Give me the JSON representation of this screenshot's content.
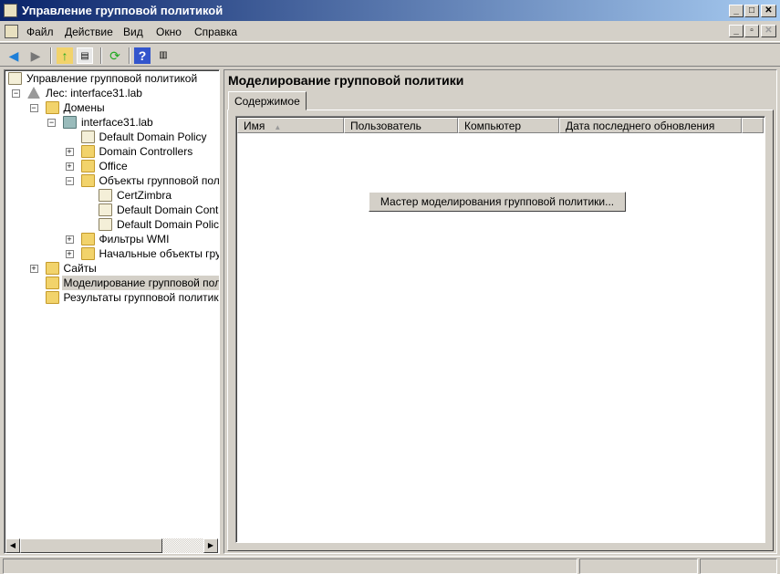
{
  "window": {
    "title": "Управление групповой политикой"
  },
  "menu": [
    "Файл",
    "Действие",
    "Вид",
    "Окно",
    "Справка"
  ],
  "toolbar": {
    "back": "back",
    "forward": "forward",
    "up": "up",
    "show_tree": "show-tree",
    "refresh": "refresh",
    "help": "help",
    "action_pane": "action-pane"
  },
  "tree": [
    {
      "label": "Управление групповой политикой",
      "level": 0,
      "expander": "",
      "icon": "gpmc"
    },
    {
      "label": "Лес: interface31.lab",
      "level": 1,
      "expander": "-",
      "icon": "forest"
    },
    {
      "label": "Домены",
      "level": 2,
      "expander": "-",
      "icon": "domains"
    },
    {
      "label": "interface31.lab",
      "level": 3,
      "expander": "-",
      "icon": "domain"
    },
    {
      "label": "Default Domain Policy",
      "level": 4,
      "expander": "",
      "icon": "gpo-link"
    },
    {
      "label": "Domain Controllers",
      "level": 4,
      "expander": "+",
      "icon": "ou"
    },
    {
      "label": "Office",
      "level": 4,
      "expander": "+",
      "icon": "ou"
    },
    {
      "label": "Объекты групповой полит",
      "level": 4,
      "expander": "-",
      "icon": "gpo-folder"
    },
    {
      "label": "CertZimbra",
      "level": 5,
      "expander": "",
      "icon": "gpo"
    },
    {
      "label": "Default Domain Controlle",
      "level": 5,
      "expander": "",
      "icon": "gpo"
    },
    {
      "label": "Default Domain Policy",
      "level": 5,
      "expander": "",
      "icon": "gpo"
    },
    {
      "label": "Фильтры WMI",
      "level": 4,
      "expander": "+",
      "icon": "wmi"
    },
    {
      "label": "Начальные объекты групп",
      "level": 4,
      "expander": "+",
      "icon": "starter"
    },
    {
      "label": "Сайты",
      "level": 2,
      "expander": "+",
      "icon": "sites"
    },
    {
      "label": "Моделирование групповой полити",
      "level": 2,
      "expander": "",
      "icon": "modeling",
      "selected": true
    },
    {
      "label": "Результаты групповой политики",
      "level": 2,
      "expander": "",
      "icon": "results"
    }
  ],
  "main": {
    "title": "Моделирование групповой политики",
    "tab": "Содержимое",
    "columns": [
      "Имя",
      "Пользователь",
      "Компьютер",
      "Дата последнего обновления"
    ],
    "wizard_button": "Мастер моделирования групповой политики..."
  }
}
